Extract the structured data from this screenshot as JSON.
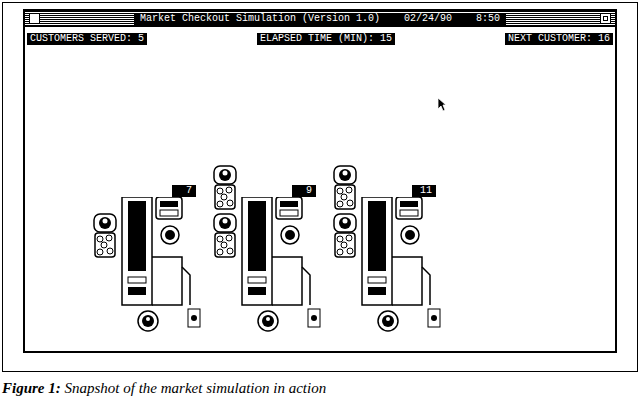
{
  "window": {
    "title": "Market Checkout Simulation (Version 1.0)",
    "date": "02/24/90",
    "time": "8:50"
  },
  "status": [
    {
      "label": "CUSTOMERS SERVED: 5"
    },
    {
      "label": "ELAPSED TIME (MIN): 15"
    },
    {
      "label": "NEXT CUSTOMER: 16"
    }
  ],
  "lanes": [
    {
      "counter": "7",
      "waiting": 1
    },
    {
      "counter": "9",
      "waiting": 2
    },
    {
      "counter": "11",
      "waiting": 2
    }
  ],
  "caption": {
    "label": "Figure 1:",
    "text": "Snapshot of the market simulation in action"
  }
}
